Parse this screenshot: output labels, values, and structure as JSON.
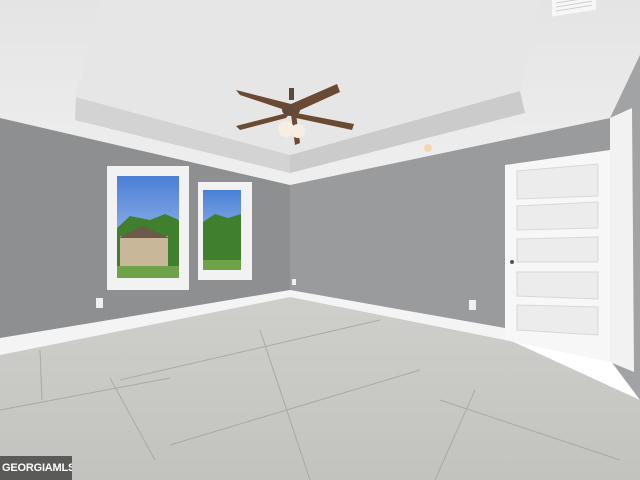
{
  "image": {
    "description_tag": "empty-bedroom-photo",
    "watermark_text": "GEORGIAMLS"
  },
  "colors": {
    "ceiling": "#e9e9e9",
    "left_wall": "#8f9091",
    "back_wall": "#9a9b9d",
    "trim": "#f4f4f4",
    "floor": "#c9c9c6",
    "door": "#f7f7f7",
    "sky": "#5f8fd9",
    "trees": "#3f7f2e"
  }
}
